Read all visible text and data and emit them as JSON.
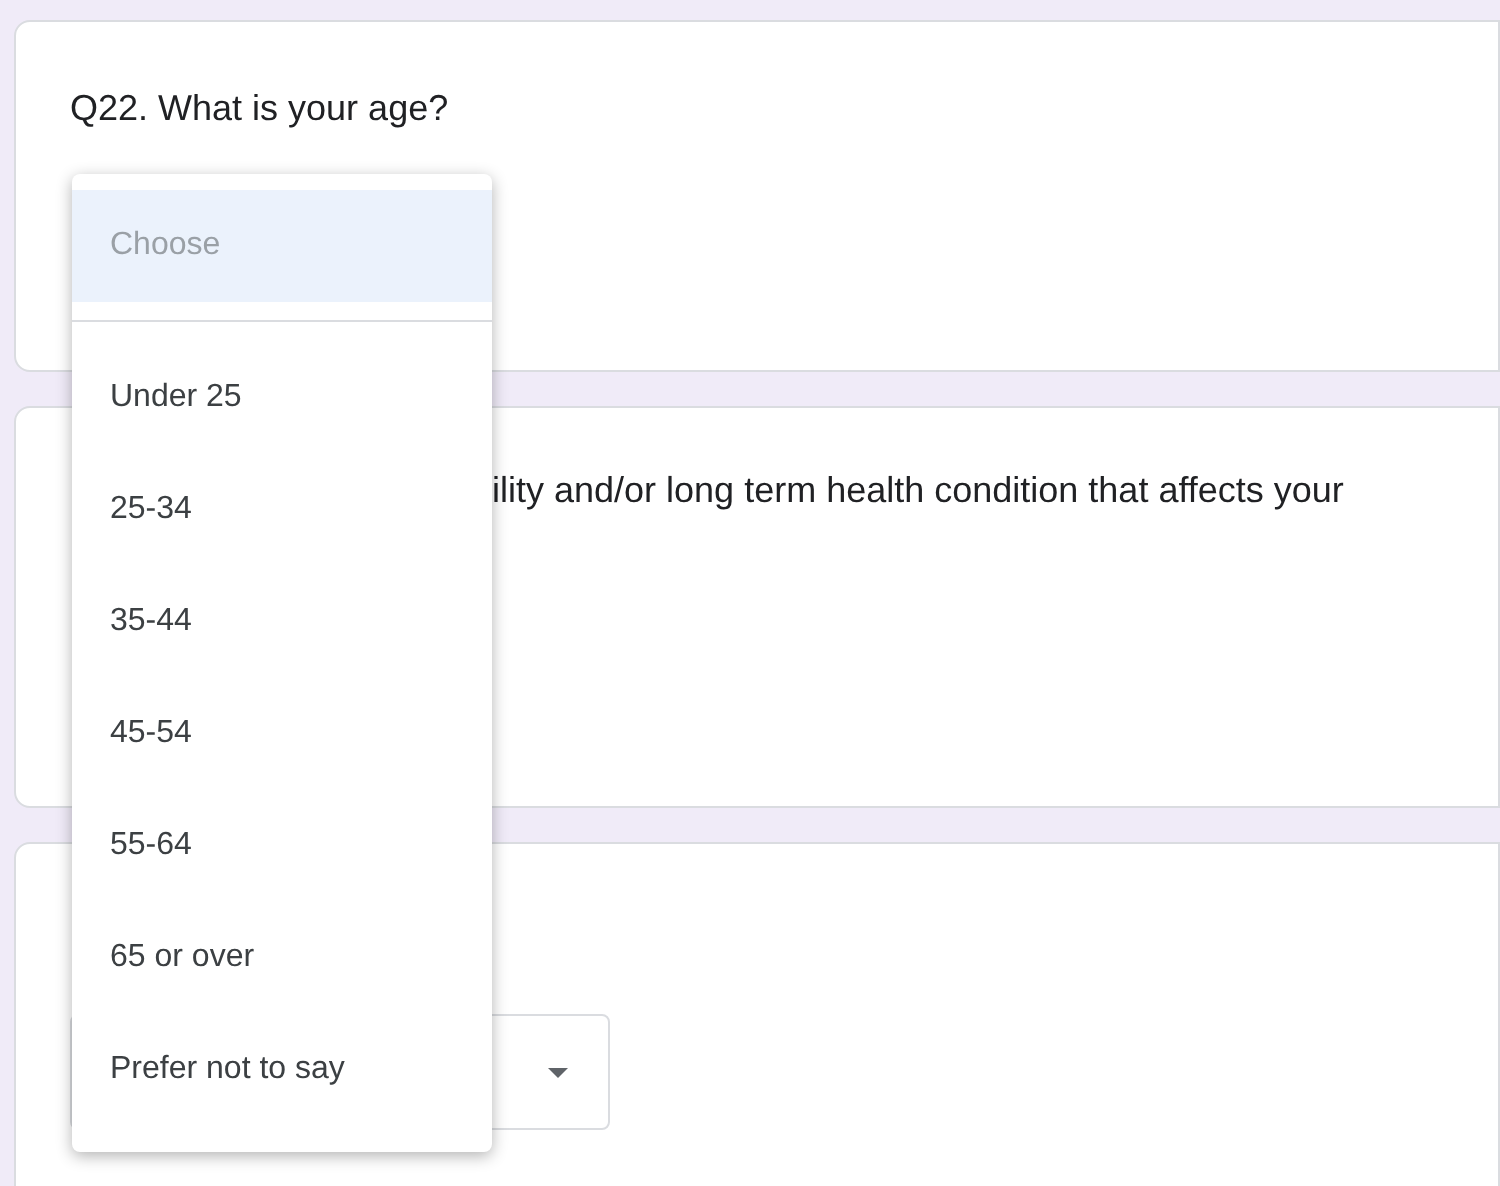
{
  "questions": [
    {
      "title": "Q22. What is your age?"
    },
    {
      "title": "ility and/or long term health condition that affects your"
    },
    {
      "select": {
        "open": false
      }
    }
  ],
  "dropdown": {
    "options": [
      {
        "kind": "placeholder",
        "label": "Choose",
        "selected": true
      },
      {
        "kind": "option",
        "label": "Under 25",
        "selected": false
      },
      {
        "kind": "option",
        "label": "25-34",
        "selected": false
      },
      {
        "kind": "option",
        "label": "35-44",
        "selected": false
      },
      {
        "kind": "option",
        "label": "45-54",
        "selected": false
      },
      {
        "kind": "option",
        "label": "55-64",
        "selected": false
      },
      {
        "kind": "option",
        "label": "65 or over",
        "selected": false
      },
      {
        "kind": "option",
        "label": "Prefer not to say",
        "selected": false
      }
    ]
  }
}
